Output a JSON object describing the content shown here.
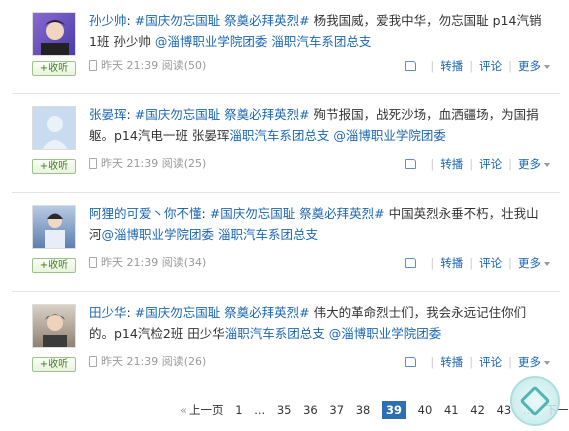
{
  "posts": [
    {
      "author": "孙少帅",
      "colon": ":",
      "tag": "#国庆勿忘国耻 祭奠必拜英烈#",
      "text": "杨我国威，爱我中华，勿忘国耻 p14汽销1班 孙少帅",
      "mention1": "@淄博职业学院团委",
      "mention2": "淄职汽车系团总支",
      "follow": "+收听",
      "time": "昨天 21:39",
      "views": "阅读(50)",
      "actions": {
        "repost": "转播",
        "comment": "评论",
        "more": "更多"
      },
      "avatar_color": "#6a5cc0"
    },
    {
      "author": "张晏珲",
      "colon": ":",
      "tag": "#国庆勿忘国耻 祭奠必拜英烈#",
      "text": "殉节报国，战死沙场，血洒疆场，为国捐躯。p14汽电一班 张晏珲",
      "mention1": "淄职汽车系团总支",
      "mention2": "@淄博职业学院团委",
      "follow": "+收听",
      "time": "昨天 21:39",
      "views": "阅读(25)",
      "actions": {
        "repost": "转播",
        "comment": "评论",
        "more": "更多"
      },
      "avatar_color": "#c7d9ee"
    },
    {
      "author": "阿狸的可爱丶你不懂",
      "colon": ":",
      "tag": "#国庆勿忘国耻 祭奠必拜英烈#",
      "text": "中国英烈永垂不朽，壮我山河",
      "mention1": "@淄博职业学院团委",
      "mention2": "淄职汽车系团总支",
      "follow": "+收听",
      "time": "昨天 21:39",
      "views": "阅读(34)",
      "actions": {
        "repost": "转播",
        "comment": "评论",
        "more": "更多"
      },
      "avatar_color": "#6f8fb8"
    },
    {
      "author": "田少华",
      "colon": ":",
      "tag": "#国庆勿忘国耻 祭奠必拜英烈#",
      "text": "伟大的革命烈士们，我会永远记住你们的。p14汽检2班 田少华",
      "mention1": "淄职汽车系团总支",
      "mention2": "@淄博职业学院团委",
      "follow": "+收听",
      "time": "昨天 21:39",
      "views": "阅读(26)",
      "actions": {
        "repost": "转播",
        "comment": "评论",
        "more": "更多"
      },
      "avatar_color": "#8a7a6a"
    }
  ],
  "pager": {
    "prev": "上一页",
    "next": "下一页",
    "pages": [
      "1",
      "...",
      "35",
      "36",
      "37",
      "38",
      "39",
      "40",
      "41",
      "42",
      "43",
      "..."
    ],
    "current": "39"
  }
}
